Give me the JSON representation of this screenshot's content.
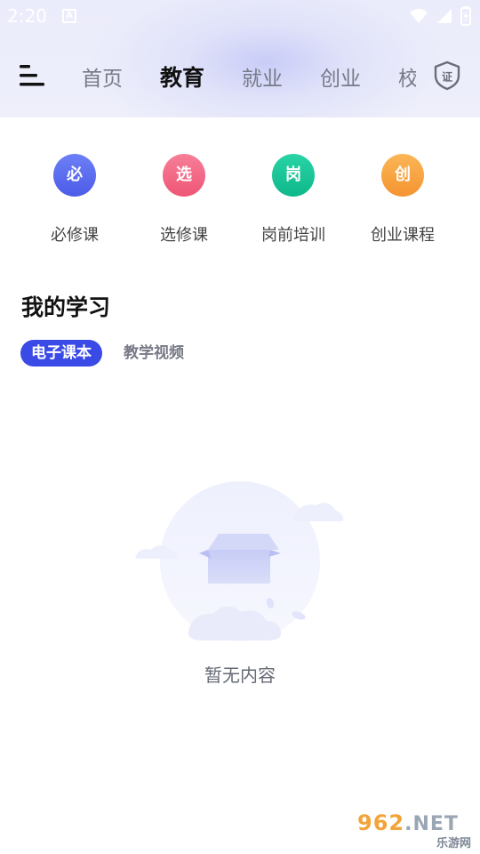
{
  "status_bar": {
    "time": "2:20",
    "notification_icon": "a-icon",
    "icons": [
      "wifi-icon",
      "cellular-signal-icon",
      "battery-icon"
    ]
  },
  "nav": {
    "menu_icon": "menu-icon",
    "tabs": [
      {
        "label": "首页",
        "active": false
      },
      {
        "label": "教育",
        "active": true
      },
      {
        "label": "就业",
        "active": false
      },
      {
        "label": "创业",
        "active": false
      },
      {
        "label": "校训",
        "active": false
      }
    ],
    "right_icon": "certificate-shield-icon",
    "right_icon_glyph": "证"
  },
  "categories": [
    {
      "glyph": "必",
      "label": "必修课",
      "color": "#5b6df0"
    },
    {
      "glyph": "选",
      "label": "选修课",
      "color": "#f26683"
    },
    {
      "glyph": "岗",
      "label": "岗前培训",
      "color": "#16c496"
    },
    {
      "glyph": "创",
      "label": "创业课程",
      "color": "#f9a23c"
    }
  ],
  "section": {
    "title": "我的学习",
    "sub_tabs": [
      {
        "label": "电子课本",
        "active": true
      },
      {
        "label": "教学视频",
        "active": false
      }
    ]
  },
  "empty_state": {
    "icon": "empty-box-icon",
    "text": "暂无内容"
  },
  "watermark": {
    "brand": "962",
    "suffix": ".NET",
    "subtitle": "乐游网"
  },
  "colors": {
    "accent": "#3a4ae6",
    "header_bg": "#ebecfb"
  }
}
